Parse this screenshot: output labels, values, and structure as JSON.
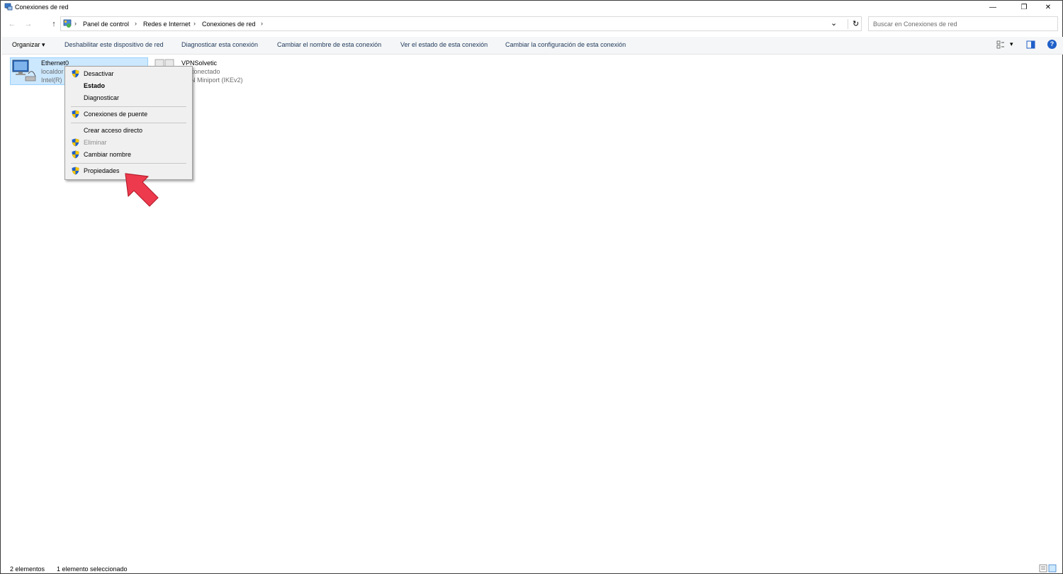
{
  "window": {
    "title": "Conexiones de red",
    "minimize": "—",
    "restore": "❐",
    "close": "✕"
  },
  "nav": {
    "back": "←",
    "forward": "→",
    "up": "↑",
    "breadcrumb": [
      "Panel de control",
      "Redes e Internet",
      "Conexiones de red"
    ],
    "separator": "›",
    "dropdown": "⌄",
    "refresh": "↻"
  },
  "search": {
    "placeholder": "Buscar en Conexiones de red"
  },
  "toolbar": {
    "organize": "Organizar",
    "organize_caret": "▾",
    "commands": [
      "Deshabilitar este dispositivo de red",
      "Diagnosticar esta conexión",
      "Cambiar el nombre de esta conexión",
      "Ver el estado de esta conexión",
      "Cambiar la configuración de esta conexión"
    ],
    "view_caret": "▾",
    "help": "?"
  },
  "connections": [
    {
      "name": "Ethernet0",
      "status": "localdor",
      "device": "Intel(R)",
      "selected": true
    },
    {
      "name": "VPNSolvetic",
      "status": "conectado",
      "device": "N Miniport (IKEv2)",
      "selected": false
    }
  ],
  "context_menu": {
    "items": [
      {
        "label": "Desactivar",
        "shield": true,
        "bold": false,
        "disabled": false
      },
      {
        "label": "Estado",
        "shield": false,
        "bold": true,
        "disabled": false
      },
      {
        "label": "Diagnosticar",
        "shield": false,
        "bold": false,
        "disabled": false
      },
      {
        "label": "Conexiones de puente",
        "shield": true,
        "bold": false,
        "disabled": false
      },
      {
        "label": "Crear acceso directo",
        "shield": false,
        "bold": false,
        "disabled": false
      },
      {
        "label": "Eliminar",
        "shield": true,
        "bold": false,
        "disabled": true
      },
      {
        "label": "Cambiar nombre",
        "shield": true,
        "bold": false,
        "disabled": false
      },
      {
        "label": "Propiedades",
        "shield": true,
        "bold": false,
        "disabled": false
      }
    ]
  },
  "status_bar": {
    "count": "2 elementos",
    "selection": "1 elemento seleccionado"
  },
  "colors": {
    "selection": "#cce8ff",
    "arrow": "#ee3a4d",
    "shield_blue": "#1e5fc9",
    "shield_yellow": "#f5c400"
  }
}
